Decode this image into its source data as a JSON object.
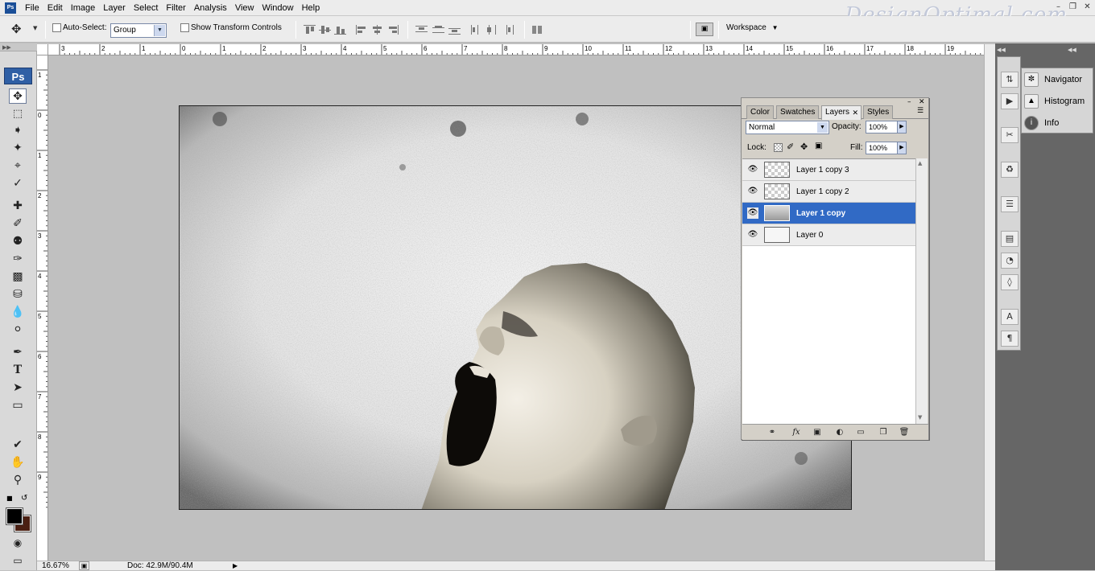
{
  "menubar": {
    "items": [
      "File",
      "Edit",
      "Image",
      "Layer",
      "Select",
      "Filter",
      "Analysis",
      "View",
      "Window",
      "Help"
    ],
    "watermark": "DesignOptimal.com"
  },
  "options": {
    "auto_select_label": "Auto-Select:",
    "auto_select_value": "Group",
    "transform_label": "Show Transform Controls",
    "workspace_label": "Workspace"
  },
  "toolbox": {
    "logo": "Ps"
  },
  "ruler": {
    "top_ticks": [
      "3",
      "2",
      "1",
      "0",
      "1",
      "2",
      "3",
      "4",
      "5",
      "6",
      "7",
      "8",
      "9",
      "10",
      "11",
      "12",
      "13",
      "14",
      "15",
      "16",
      "17",
      "18",
      "19"
    ],
    "left_ticks": [
      "1",
      "0",
      "1",
      "2",
      "3",
      "4",
      "5",
      "6",
      "7",
      "8",
      "9"
    ]
  },
  "status": {
    "zoom": "16.67%",
    "doc": "Doc: 42.9M/90.4M"
  },
  "minipanel": {
    "items": [
      "Navigator",
      "Histogram",
      "Info"
    ]
  },
  "layers_panel": {
    "tabs": [
      "Color",
      "Swatches",
      "Layers",
      "Styles"
    ],
    "active_tab": "Layers",
    "blend_mode": "Normal",
    "opacity_label": "Opacity:",
    "opacity_value": "100%",
    "lock_label": "Lock:",
    "fill_label": "Fill:",
    "fill_value": "100%",
    "layers": [
      {
        "name": "Layer 1 copy 3",
        "selected": false
      },
      {
        "name": "Layer 1 copy 2",
        "selected": false
      },
      {
        "name": "Layer 1 copy",
        "selected": true
      },
      {
        "name": "Layer 0",
        "selected": false
      }
    ]
  },
  "colors": {
    "selection": "#316ac5",
    "foreground": "#000000",
    "background": "#4a1f12"
  }
}
